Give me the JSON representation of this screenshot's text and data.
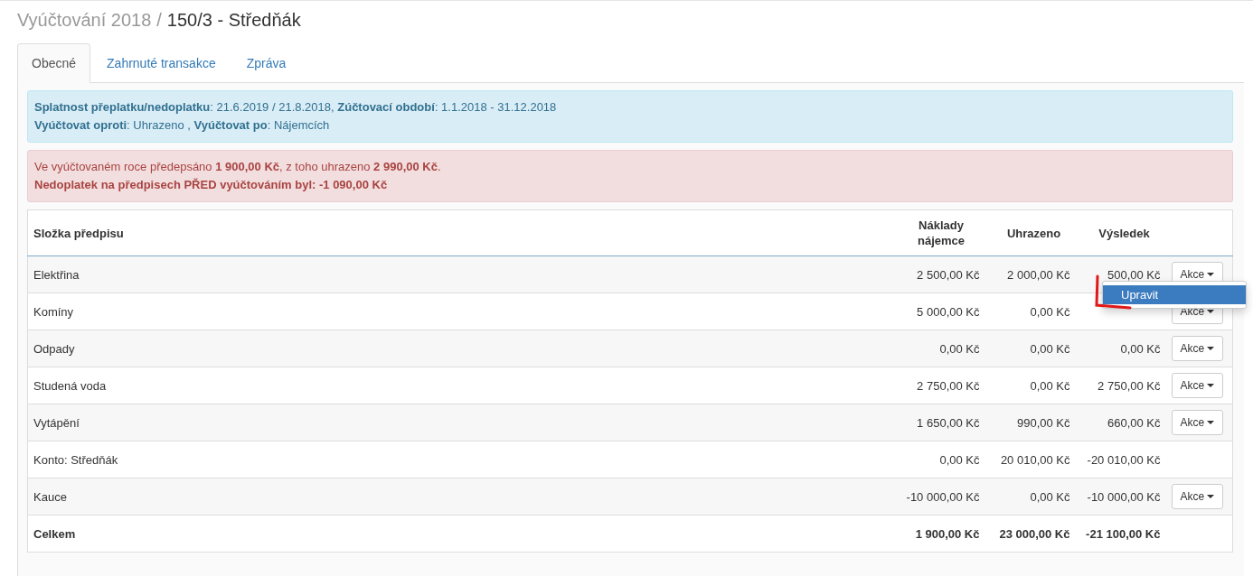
{
  "title": {
    "section": "Vyúčtování 2018",
    "separator": "/",
    "subject": "150/3 - Středňák"
  },
  "tabs": [
    {
      "label": "Obecné",
      "selected": true
    },
    {
      "label": "Zahrnuté transakce",
      "selected": false
    },
    {
      "label": "Zpráva",
      "selected": false
    }
  ],
  "info_alert": [
    "**Splatnost přeplatku/nedoplatku**: 21.6.2019 / 21.8.2018, **Zúčtovací období**: 1.1.2018 - 31.12.2018",
    "**Vyúčtovat oproti**: Uhrazeno , **Vyúčtovat po**: Nájemcích"
  ],
  "danger_alert": [
    "Ve vyúčtovaném roce předepsáno **1 900,00 Kč**, z toho uhrazeno **2 990,00 Kč**.",
    "**Nedoplatek na předpisech PŘED vyúčtováním byl: -1 090,00 Kč**"
  ],
  "table": {
    "columns": [
      "Složka předpisu",
      "Náklady nájemce",
      "Uhrazeno",
      "Výsledek"
    ],
    "rows": [
      {
        "kind": "item",
        "cells": [
          "Elektřina",
          "2 500,00 Kč",
          "2 000,00 Kč",
          "500,00 Kč"
        ],
        "action": "Akce"
      },
      {
        "kind": "item",
        "cells": [
          "Komíny",
          "5 000,00 Kč",
          "0,00 Kč"
        ],
        "action": "Akce"
      },
      {
        "kind": "item",
        "cells": [
          "Odpady",
          "0,00 Kč",
          "0,00 Kč",
          "0,00 Kč"
        ],
        "action": "Akce"
      },
      {
        "kind": "item",
        "cells": [
          "Studená voda",
          "2 750,00 Kč",
          "0,00 Kč",
          "2 750,00 Kč"
        ],
        "action": "Akce"
      },
      {
        "kind": "item",
        "cells": [
          "Vytápění",
          "1 650,00 Kč",
          "990,00 Kč",
          "660,00 Kč"
        ],
        "action": "Akce"
      },
      {
        "kind": "plain",
        "cells": [
          "Konto: Středňák",
          "0,00 Kč",
          "20 010,00 Kč",
          "-20 010,00 Kč"
        ]
      },
      {
        "kind": "item",
        "cells": [
          "Kauce",
          "-10 000,00 Kč",
          "0,00 Kč",
          "-10 000,00 Kč"
        ],
        "action": "Akce"
      },
      {
        "kind": "total",
        "cells": [
          "Celkem",
          "1 900,00 Kč",
          "23 000,00 Kč",
          "-21 100,00 Kč"
        ]
      }
    ]
  },
  "dropdown_menu": {
    "items": [
      {
        "label": "Upravit",
        "selected": true
      }
    ]
  }
}
